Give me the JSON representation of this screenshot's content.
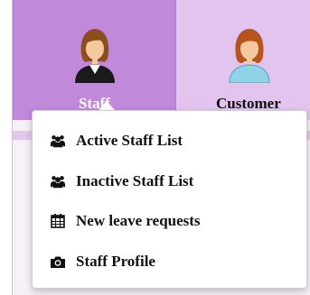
{
  "nav": {
    "tabs": [
      {
        "label": "Staff",
        "icon": "female-staff-avatar-icon",
        "active": true
      },
      {
        "label": "Customer",
        "icon": "female-customer-avatar-icon",
        "active": false
      }
    ]
  },
  "dropdown": {
    "items": [
      {
        "label": "Active Staff List",
        "icon": "users-icon"
      },
      {
        "label": "Inactive Staff List",
        "icon": "users-icon"
      },
      {
        "label": "New leave requests",
        "icon": "calendar-icon"
      },
      {
        "label": "Staff Profile",
        "icon": "camera-icon"
      }
    ]
  },
  "colors": {
    "active_tab": "#c089d9",
    "inactive_tab": "#e3c4ee",
    "nav_background": "#e9d2f2"
  }
}
